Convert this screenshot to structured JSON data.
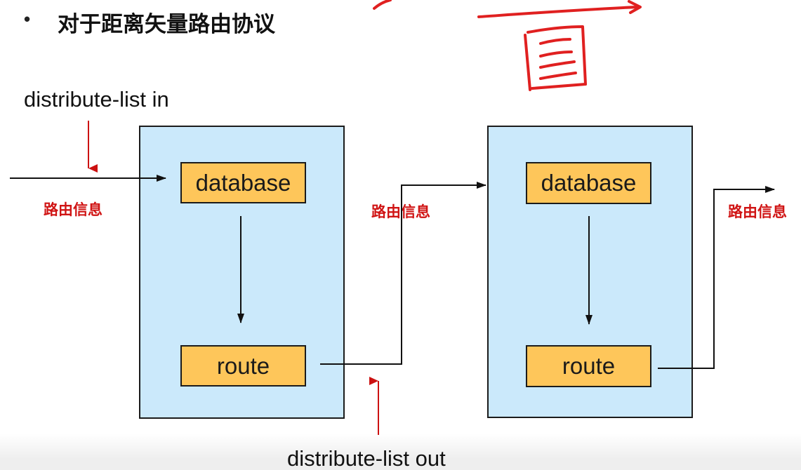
{
  "title": {
    "bullet": "•",
    "text": "对于距离矢量路由协议"
  },
  "routers": [
    {
      "database_label": "database",
      "route_label": "route"
    },
    {
      "database_label": "database",
      "route_label": "route"
    }
  ],
  "labels": {
    "distribute_list_in": "distribute-list in",
    "distribute_list_out": "distribute-list out",
    "route_info_left": "路由信息",
    "route_info_middle": "路由信息",
    "route_info_right": "路由信息"
  },
  "colors": {
    "router_fill": "#cbe9fb",
    "node_fill": "#fec65a",
    "route_info_text": "#d01414",
    "marker_arrow": "#cc1111",
    "flow_line": "#111111"
  }
}
